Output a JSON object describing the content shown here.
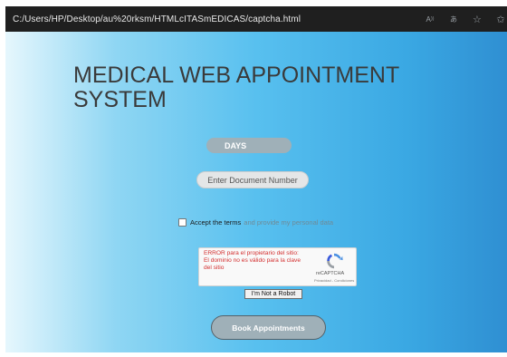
{
  "browser": {
    "url": "C:/Users/HP/Desktop/au%20rksm/HTMLcITASmEDICAS/captcha.html",
    "icons": [
      "read-aloud-icon",
      "translate-icon",
      "favorites-icon",
      "favorites-bar-icon"
    ]
  },
  "page": {
    "title": "MEDICAL WEB APPOINTMENT SYSTEM",
    "days_label": "DAYS",
    "document_placeholder": "Enter Document Number",
    "terms": {
      "accept_label": "Accept the terms",
      "provide_label": "and provide my personal data",
      "checked": false
    },
    "recaptcha": {
      "error_text": "ERROR para el propietario del sitio: El dominio no es válido para la clave del sitio",
      "brand": "reCAPTCHA",
      "links": "Privacidad - Condiciones"
    },
    "robot_button_label": "I'm Not a Robot",
    "book_button_label": "Book Appointments"
  },
  "colors": {
    "address_bar": "#1f1f1f",
    "gradient_start": "#e6f7fd",
    "gradient_end": "#2f8fd2",
    "button_fill": "#9fb0b8",
    "error_text": "#d32f2f"
  }
}
